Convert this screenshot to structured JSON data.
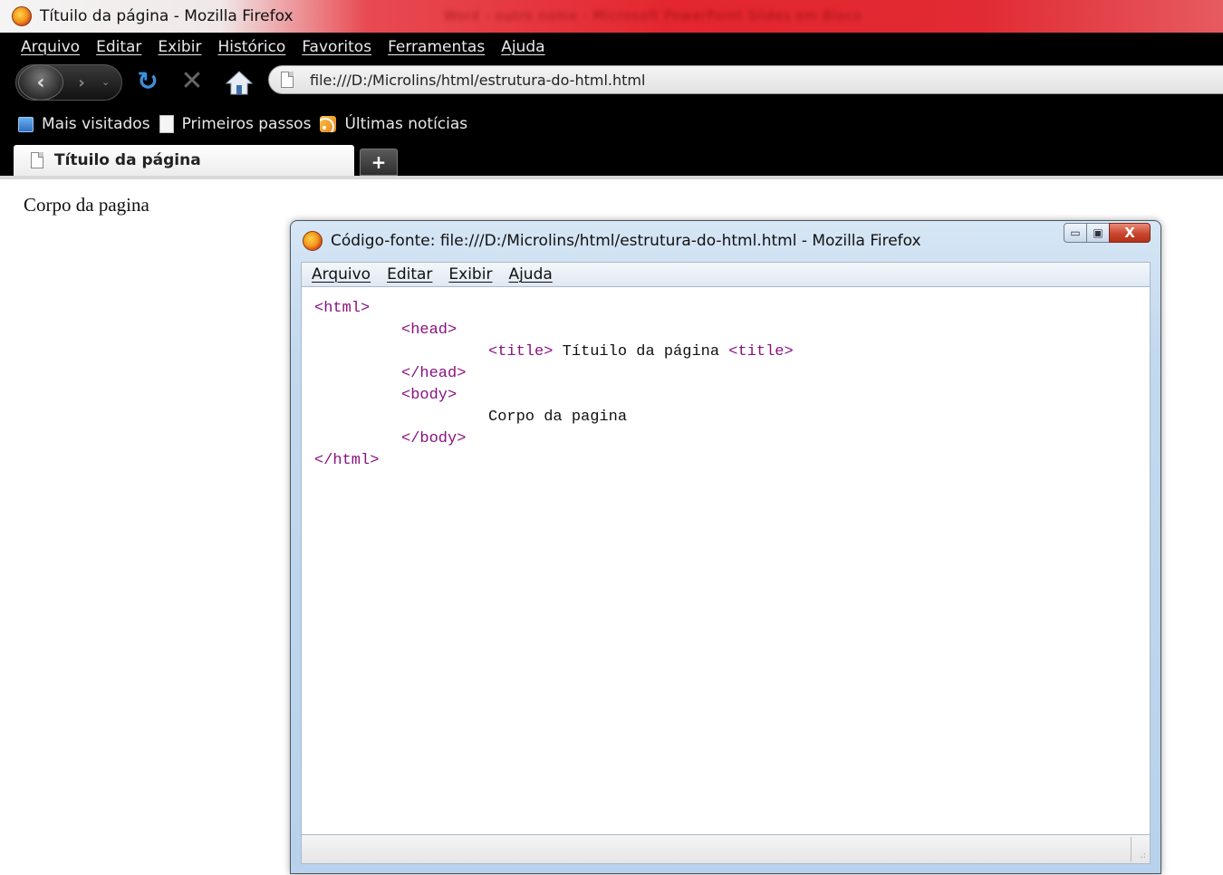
{
  "main_window": {
    "title": "Títuilo da página - Mozilla Firefox",
    "blurred_title": "Word - outro nome - Microsoft PowerPoint Slides em Bloco"
  },
  "menubar": {
    "items": [
      "Arquivo",
      "Editar",
      "Exibir",
      "Histórico",
      "Favoritos",
      "Ferramentas",
      "Ajuda"
    ]
  },
  "navigation": {
    "back_label": "‹",
    "forward_label": "›",
    "history_dropdown": "⌄",
    "reload_label": "↻",
    "stop_label": "✕",
    "url": "file:///D:/Microlins/html/estrutura-do-html.html"
  },
  "bookmarks": {
    "items": [
      "Mais visitados",
      "Primeiros passos",
      "Últimas notícias"
    ]
  },
  "tabs": {
    "active_label": "Títuilo da página",
    "new_tab_label": "+"
  },
  "page": {
    "body_text": "Corpo da pagina"
  },
  "source_window": {
    "title": "Código-fonte: file:///D:/Microlins/html/estrutura-do-html.html - Mozilla Firefox",
    "buttons": {
      "minimize": "▭",
      "maximize": "▣",
      "close": "X"
    },
    "menubar": [
      "Arquivo",
      "Editar",
      "Exibir",
      "Ajuda"
    ],
    "code": {
      "html_open": "<html>",
      "head_open": "<head>",
      "title_open": "<title>",
      "title_text": " Títuilo da página ",
      "title_close": "<title>",
      "head_close": "</head>",
      "body_open": "<body>",
      "body_text": "Corpo da pagina",
      "body_close": "</body>",
      "html_close": "</html>"
    },
    "grip": ".:"
  },
  "colors": {
    "tag": "#881280",
    "chrome_bg": "#000000",
    "titlebar_red": "#e3262f",
    "reload_blue": "#3d8fe0"
  }
}
